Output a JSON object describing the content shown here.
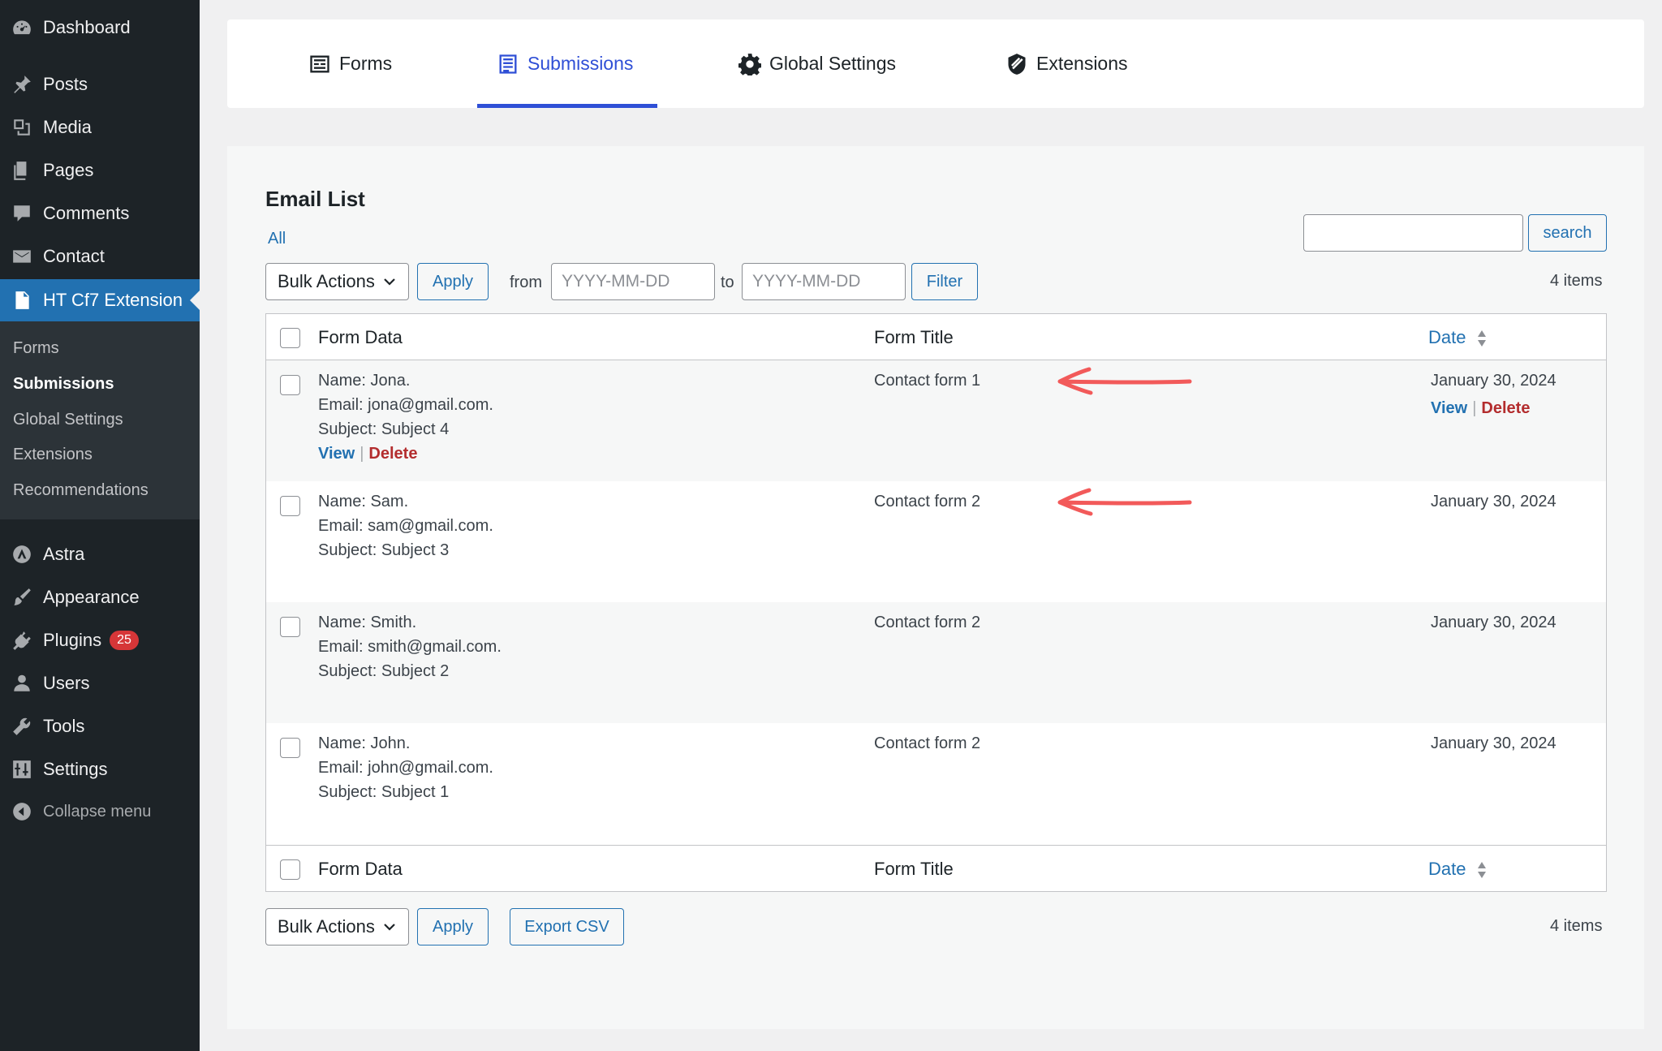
{
  "sidebar": {
    "items": [
      {
        "label": "Dashboard",
        "icon": "dashboard-icon"
      },
      {
        "label": "Posts",
        "icon": "pin-icon"
      },
      {
        "label": "Media",
        "icon": "media-icon"
      },
      {
        "label": "Pages",
        "icon": "pages-icon"
      },
      {
        "label": "Comments",
        "icon": "comment-icon"
      },
      {
        "label": "Contact",
        "icon": "mail-icon"
      },
      {
        "label": "HT Cf7 Extension",
        "icon": "document-icon"
      },
      {
        "label": "Astra",
        "icon": "astra-icon"
      },
      {
        "label": "Appearance",
        "icon": "brush-icon"
      },
      {
        "label": "Plugins",
        "icon": "plug-icon",
        "badge": "25"
      },
      {
        "label": "Users",
        "icon": "user-icon"
      },
      {
        "label": "Tools",
        "icon": "wrench-icon"
      },
      {
        "label": "Settings",
        "icon": "settings-icon"
      },
      {
        "label": "Collapse menu",
        "icon": "collapse-icon"
      }
    ],
    "submenu": [
      "Forms",
      "Submissions",
      "Global Settings",
      "Extensions",
      "Recommendations"
    ],
    "colors": {
      "bg": "#1d2327",
      "active": "#2271b1",
      "badge": "#d63638"
    }
  },
  "tabs": [
    {
      "label": "Forms",
      "icon": "form-icon"
    },
    {
      "label": "Submissions",
      "icon": "list-icon"
    },
    {
      "label": "Global Settings",
      "icon": "gear-icon"
    },
    {
      "label": "Extensions",
      "icon": "extension-icon"
    }
  ],
  "main": {
    "title": "Email List",
    "filter_all": "All",
    "bulk_actions": "Bulk Actions",
    "apply": "Apply",
    "from_label": "from",
    "to_label": "to",
    "date_placeholder": "YYYY-MM-DD",
    "filter_button": "Filter",
    "search_button": "search",
    "items_count": "4 items",
    "export_csv": "Export CSV"
  },
  "table": {
    "columns": [
      "Form Data",
      "Form Title",
      "Date"
    ],
    "row_actions": {
      "view": "View",
      "delete": "Delete",
      "separator": "|"
    },
    "rows": [
      {
        "name": "Name: Jona.",
        "email": "Email: jona@gmail.com.",
        "subject": "Subject: Subject 4",
        "form_title": "Contact form 1",
        "date": "January 30, 2024"
      },
      {
        "name": "Name: Sam.",
        "email": "Email: sam@gmail.com.",
        "subject": "Subject: Subject 3",
        "form_title": "Contact form 2",
        "date": "January 30, 2024"
      },
      {
        "name": "Name: Smith.",
        "email": "Email: smith@gmail.com.",
        "subject": "Subject: Subject 2",
        "form_title": "Contact form 2",
        "date": "January 30, 2024"
      },
      {
        "name": "Name: John.",
        "email": "Email: john@gmail.com.",
        "subject": "Subject: Subject 1",
        "form_title": "Contact form 2",
        "date": "January 30, 2024"
      }
    ]
  },
  "annotation": {
    "arrow_color": "#f25a5a"
  }
}
